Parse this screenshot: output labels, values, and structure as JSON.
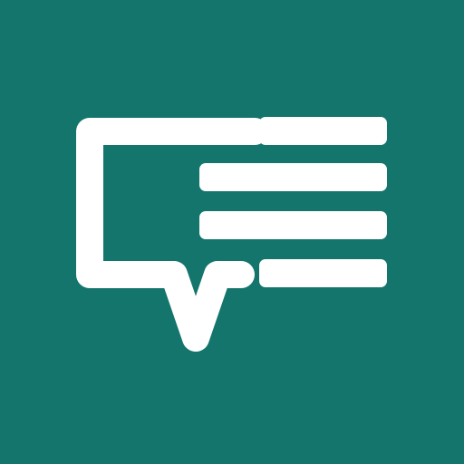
{
  "icon": {
    "name": "chat-bubble-text-lines-icon",
    "colors": {
      "background": "#13756C",
      "foreground": "#FFFFFF"
    }
  }
}
